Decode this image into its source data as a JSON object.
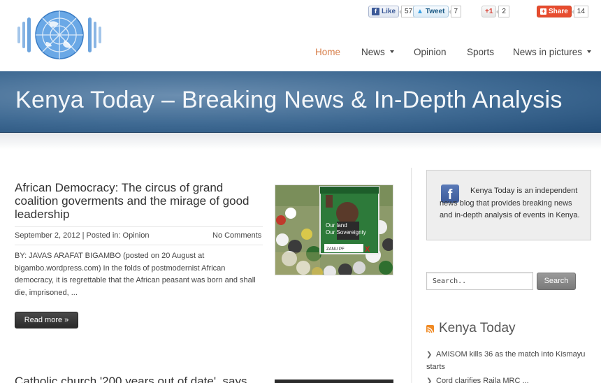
{
  "social": {
    "facebook": {
      "label": "Like",
      "count": "57"
    },
    "twitter": {
      "label": "Tweet",
      "count": "7"
    },
    "google": {
      "label": "+1",
      "count": "2"
    },
    "share": {
      "label": "Share",
      "count": "14"
    }
  },
  "nav": {
    "items": [
      {
        "label": "Home",
        "active": true
      },
      {
        "label": "News",
        "dropdown": true
      },
      {
        "label": "Opinion"
      },
      {
        "label": "Sports"
      },
      {
        "label": "News in pictures",
        "dropdown": true
      }
    ]
  },
  "banner": {
    "title": "Kenya Today – Breaking News & In-Depth Analysis"
  },
  "post": {
    "title": "African Democracy: The circus of grand coalition goverments and the mirage of good leadership",
    "date": "September 2, 2012",
    "posted_in_prefix": "| Posted in:",
    "category": "Opinion",
    "comments": "No Comments",
    "excerpt": "BY: JAVAS ARAFAT BIGAMBO (posted on 20 August at bigambo.wordpress.com) In the folds of postmodernist African democracy, it is regrettable that the African peasant was born and shall die, imprisoned, ...",
    "read_more": "Read more »",
    "poster_text_1": "Our land",
    "poster_text_2": "Our Sovereignty",
    "poster_party": "ZANU PF",
    "poster_mark": "X"
  },
  "next_post": {
    "title": "Catholic church '200 years out of date', says"
  },
  "sidebar": {
    "about_text": "Kenya Today is an independent news blog that provides breaking news and in-depth analysis of events in Kenya.",
    "search_placeholder": "Search..",
    "search_button": "Search",
    "widget_title": "Kenya Today",
    "feed": [
      "AMISOM kills 36 as the match into Kismayu starts",
      "Cord clarifies Raila MRC ..."
    ]
  },
  "colors": {
    "accent": "#d77f4b",
    "banner_blue": "#3f6a93",
    "facebook_blue": "#3b5998",
    "share_orange": "#e74c2f",
    "rss_orange": "#f08a24"
  }
}
